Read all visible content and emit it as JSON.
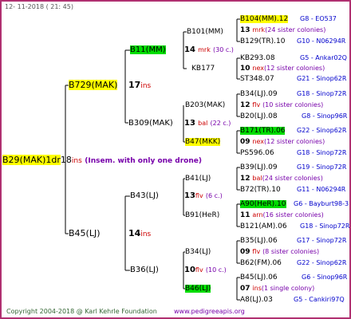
{
  "header": {
    "date": "12- 11-2018 ( 21: 45)"
  },
  "root": {
    "code": "B29(MAK)1dr",
    "num": "18",
    "unit": "ins",
    "note": "(Insem. with only one drone)"
  },
  "gen1": [
    {
      "code": "B729(MAK)",
      "num": "17",
      "unit": "ins"
    },
    {
      "code": "B45(LJ)",
      "num": "14",
      "unit": "ins"
    }
  ],
  "gen2": [
    {
      "code": "B11(MM)",
      "num": "14",
      "unit": "mrk",
      "extra": "(30 c.)"
    },
    {
      "code": "B309(MAK)",
      "num": "13",
      "unit": "bal",
      "extra": "(22 c.)"
    },
    {
      "code": "B43(LJ)",
      "num": "13",
      "unit": "flv",
      "extra": "(6 c.)"
    },
    {
      "code": "B36(LJ)",
      "num": "10",
      "unit": "flv",
      "extra": "(10 c.)"
    }
  ],
  "gen3": [
    {
      "code": "B101(MM)"
    },
    {
      "code": "KB177"
    },
    {
      "code": "B203(MAK)"
    },
    {
      "code": "B47(MKK)"
    },
    {
      "code": "B41(LJ)"
    },
    {
      "code": "B91(HeR)"
    },
    {
      "code": "B34(LJ)"
    },
    {
      "code": "B46(LJ)"
    }
  ],
  "gen4": [
    {
      "top": "B104(MM).12",
      "top_id": "G8 - EO537",
      "mid_num": "13",
      "mid_unit": "mrk",
      "mid_text": "(24 sister colonies)",
      "bot": "B129(TR).10",
      "bot_id": "G10 - N06294R"
    },
    {
      "top": "KB293.08",
      "top_id": "G5 - Ankar02Q",
      "mid_num": "10",
      "mid_unit": "nex",
      "mid_text": "(12 sister colonies)",
      "bot": "ST348.07",
      "bot_id": "G21 - Sinop62R"
    },
    {
      "top": "B34(LJ).09",
      "top_id": "G18 - Sinop72R",
      "mid_num": "12",
      "mid_unit": "flv",
      "mid_text": "(10 sister colonies)",
      "bot": "B20(LJ).08",
      "bot_id": "G8 - Sinop96R"
    },
    {
      "top": "B171(TR).06",
      "top_id": "G22 - Sinop62R",
      "mid_num": "09",
      "mid_unit": "nex",
      "mid_text": "(12 sister colonies)",
      "bot": "PS596.06",
      "bot_id": "G18 - Sinop72R"
    },
    {
      "top": "B39(LJ).09",
      "top_id": "G19 - Sinop72R",
      "mid_num": "12",
      "mid_unit": "bal",
      "mid_text": "(24 sister colonies)",
      "bot": "B72(TR).10",
      "bot_id": "G11 - N06294R"
    },
    {
      "top": "A90(HeR).10",
      "top_id": "G6 - Bayburt98-3",
      "mid_num": "11",
      "mid_unit": "arn",
      "mid_text": "(16 sister colonies)",
      "bot": "B121(AM).06",
      "bot_id": "G18 - Sinop72R"
    },
    {
      "top": "B35(LJ).06",
      "top_id": "G17 - Sinop72R",
      "mid_num": "09",
      "mid_unit": "flv",
      "mid_text": "(8 sister colonies)",
      "bot": "B62(FM).06",
      "bot_id": "G22 - Sinop62R"
    },
    {
      "top": "B45(LJ).06",
      "top_id": "G6 - Sinop96R",
      "mid_num": "07",
      "mid_unit": "ins",
      "mid_text": "(1 single colony)",
      "bot": "A8(LJ).03",
      "bot_id": "G5 - Cankiri97Q"
    }
  ],
  "footer": {
    "copyright": "Copyright 2004-2018 @ Karl Kehrle Foundation",
    "site": "www.pedigreeapis.org"
  },
  "colors": {
    "frame": "#b03070",
    "highlight_yellow": "#ffff00",
    "highlight_green": "#00dd00",
    "id_blue": "#0000cc",
    "unit_red": "#cc0000",
    "note_purple": "#7700aa"
  }
}
